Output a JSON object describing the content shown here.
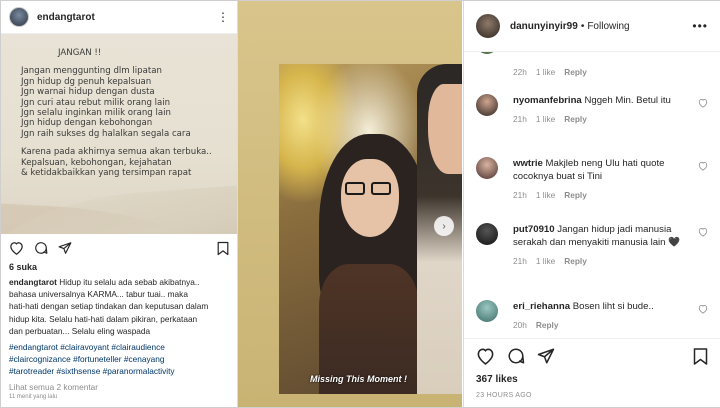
{
  "left_post": {
    "username": "endangtarot",
    "note": {
      "title": "JANGAN !!",
      "lines": [
        "Jangan menggunting dlm lipatan",
        "Jgn hidup dg penuh kepalsuan",
        "Jgn warnai hidup dengan dusta",
        "Jgn curi atau rebut milik orang lain",
        "Jgn selalu inginkan milik orang lain",
        "Jgn hidup dengan kebohongan",
        "Jgn raih sukses dg halalkan segala cara"
      ],
      "closing": [
        "Karena pada akhirnya semua akan terbuka..",
        "Kepalsuan, kebohongan, kejahatan",
        "& ketidakbaikkan yang tersimpan rapat"
      ]
    },
    "likes": "6 suka",
    "caption_user": "endangtarot",
    "caption_lines": [
      " Hidup itu selalu ada sebab akibatnya..",
      "bahasa universalnya KARMA... tabur tuai.. maka",
      "hati-hati dengan setiap tindakan dan keputusan dalam",
      "hidup kita. Selalu hati-hati dalam pikiran, perkataan",
      "dan perbuatan... Selalu eling waspada"
    ],
    "hashtags": [
      "#endangtarot #clairavoyant #clairaudience",
      "#claircognizance #fortuneteller #cenayang",
      "#tarotreader #sixthsense #paranormalactivity"
    ],
    "view_all": "Lihat semua 2 komentar",
    "time_ago": "11 menit yang lalu"
  },
  "video": {
    "caption": "Missing This Moment !"
  },
  "right_post": {
    "username": "danunyinyir99",
    "follow_status": "Following",
    "comments": [
      {
        "user": "",
        "text": "",
        "time": "22h",
        "likes": "1 like",
        "reply": "Reply"
      },
      {
        "user": "nyomanfebrina",
        "text": "Nggeh Min. Betul itu",
        "time": "21h",
        "likes": "1 like",
        "reply": "Reply"
      },
      {
        "user": "wwtrie",
        "text": "Makjleb neng Ulu hati quote cocoknya buat si Tini",
        "time": "21h",
        "likes": "1 like",
        "reply": "Reply"
      },
      {
        "user": "put70910",
        "text": "Jangan hidup jadi manusia serakah dan menyakiti manusia lain 🖤",
        "time": "21h",
        "likes": "1 like",
        "reply": "Reply"
      },
      {
        "user": "eri_riehanna",
        "text": "Bosen liht si bude..",
        "time": "20h",
        "likes": "",
        "reply": "Reply"
      }
    ],
    "likes": "367 likes",
    "time_ago": "23 HOURS AGO"
  },
  "icons": [
    "heart-icon",
    "comment-icon",
    "share-icon",
    "bookmark-icon",
    "more-icon",
    "chevron-right-icon"
  ],
  "colors": {
    "link": "#00376b",
    "muted": "#8e8e8e",
    "text": "#262626"
  }
}
